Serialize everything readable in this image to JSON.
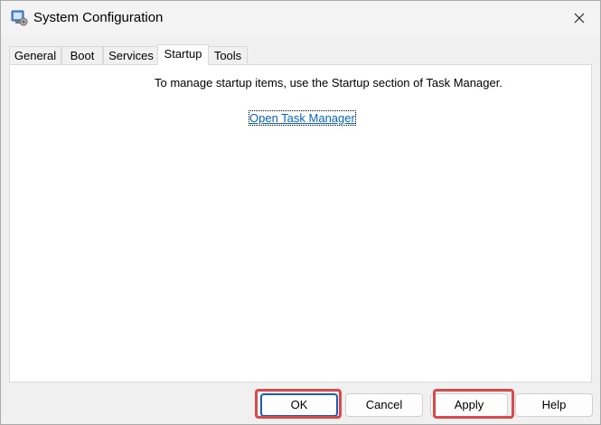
{
  "window": {
    "title": "System Configuration"
  },
  "tabs": [
    {
      "label": "General"
    },
    {
      "label": "Boot"
    },
    {
      "label": "Services"
    },
    {
      "label": "Startup"
    },
    {
      "label": "Tools"
    }
  ],
  "active_tab": "Startup",
  "startup_panel": {
    "message": "To manage startup items, use the Startup section of Task Manager.",
    "link_label": "Open Task Manager"
  },
  "buttons": {
    "ok": "OK",
    "cancel": "Cancel",
    "apply": "Apply",
    "help": "Help"
  },
  "colors": {
    "link": "#0066cc",
    "highlight": "#d94a4a",
    "focus": "#1a5fb4"
  }
}
